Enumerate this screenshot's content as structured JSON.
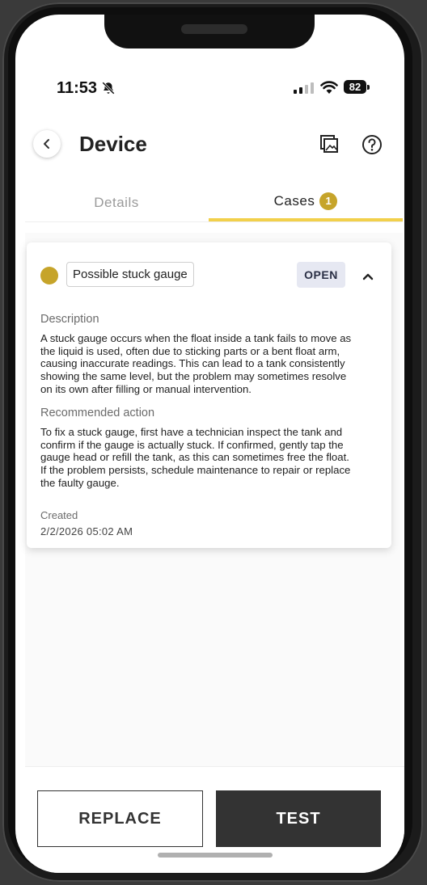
{
  "status_bar": {
    "time": "11:53",
    "battery": "82"
  },
  "header": {
    "title": "Device"
  },
  "tabs": [
    {
      "label": "Details",
      "active": false
    },
    {
      "label": "Cases",
      "active": true,
      "badge": "1"
    }
  ],
  "case": {
    "title": "Possible stuck gauge",
    "status": "OPEN",
    "status_color": "#c6a42a",
    "description_label": "Description",
    "description_lines": [
      "A stuck gauge occurs when the float inside a tank fails to move as",
      "the liquid is used, often due to sticking parts or a bent float arm,",
      "causing inaccurate readings. This can lead to a tank consistently",
      "showing the same level, but the problem may sometimes resolve",
      "on its own after filling or manual intervention."
    ],
    "action_label": "Recommended action",
    "action_lines": [
      "To fix a stuck gauge, first have a technician inspect the tank and",
      "confirm if the gauge is actually stuck. If confirmed, gently tap the",
      "gauge head or refill the tank, as this can sometimes free the float.",
      "If the problem persists, schedule maintenance to repair or replace",
      "the faulty gauge."
    ],
    "created_label": "Created",
    "created_value": "2/2/2026 05:02 AM"
  },
  "footer": {
    "replace_label": "REPLACE",
    "test_label": "TEST"
  },
  "icons": {
    "back": "chevron-left-icon",
    "gallery": "gallery-icon",
    "help": "help-icon",
    "collapse": "chevron-up-icon",
    "bell_muted": "bell-slash-icon"
  },
  "colors": {
    "accent": "#f2d04b",
    "badge": "#c6a42a",
    "dark_button": "#333333"
  }
}
